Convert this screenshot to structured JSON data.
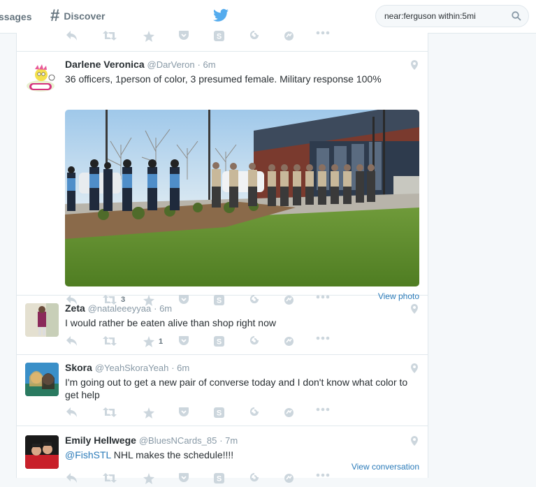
{
  "nav": {
    "messages_label": "ssages",
    "discover_label": "Discover",
    "search_value": "near:ferguson within:5mi"
  },
  "tweets": [
    {
      "fullname": "Darlene Veronica",
      "handle": "@DarVeron",
      "time": "· 6m",
      "text": "36 officers, 1person of color,  3 presumed female. Military response 100%",
      "retweet_count": "3",
      "favorite_count": "",
      "link": "View photo"
    },
    {
      "fullname": "Zeta",
      "handle": "@nataleeeyyaa",
      "time": "· 6m",
      "text": "I would rather be eaten alive than shop right now",
      "retweet_count": "",
      "favorite_count": "1"
    },
    {
      "fullname": "Skora",
      "handle": "@YeahSkoraYeah",
      "time": "· 6m",
      "text": "I'm going out to get a new pair of converse today and I don't know what color to get help"
    },
    {
      "fullname": "Emily Hellwege",
      "handle": "@BluesNCards_85",
      "time": "· 7m",
      "mention": "@FishSTL",
      "text": " NHL makes the schedule!!!!",
      "link": "View conversation"
    }
  ],
  "icons": [
    "reply-icon",
    "retweet-icon",
    "favorite-icon",
    "pocket-icon",
    "skype-icon",
    "swirl-icon",
    "disqus-icon",
    "more-icon"
  ],
  "colors": {
    "link": "#2b7bb9",
    "icon": "#ccd6dd",
    "brand": "#55acee"
  }
}
